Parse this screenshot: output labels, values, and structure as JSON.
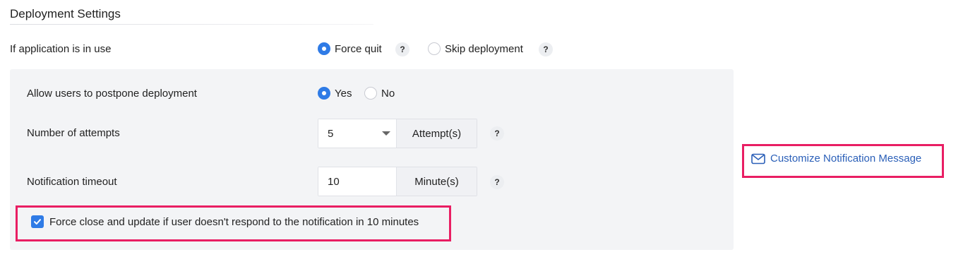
{
  "section": {
    "title": "Deployment Settings"
  },
  "in_use": {
    "label": "If application is in use",
    "options": [
      {
        "label": "Force quit",
        "selected": true
      },
      {
        "label": "Skip deployment",
        "selected": false
      }
    ],
    "help": "?"
  },
  "postpone": {
    "label": "Allow users to postpone deployment",
    "options": [
      {
        "label": "Yes",
        "selected": true
      },
      {
        "label": "No",
        "selected": false
      }
    ]
  },
  "attempts": {
    "label": "Number of attempts",
    "value": "5",
    "unit": "Attempt(s)",
    "help": "?"
  },
  "timeout": {
    "label": "Notification timeout",
    "value": "10",
    "unit": "Minute(s)",
    "help": "?"
  },
  "force_close": {
    "label": "Force close and update if user doesn't respond to the notification in 10 minutes",
    "checked": true
  },
  "notification_link": {
    "label": "Customize Notification Message",
    "icon": "mail-icon"
  },
  "colors": {
    "accent": "#2f7be6",
    "highlight": "#e91e63",
    "link": "#2a5fb8",
    "panel": "#f3f4f6"
  }
}
